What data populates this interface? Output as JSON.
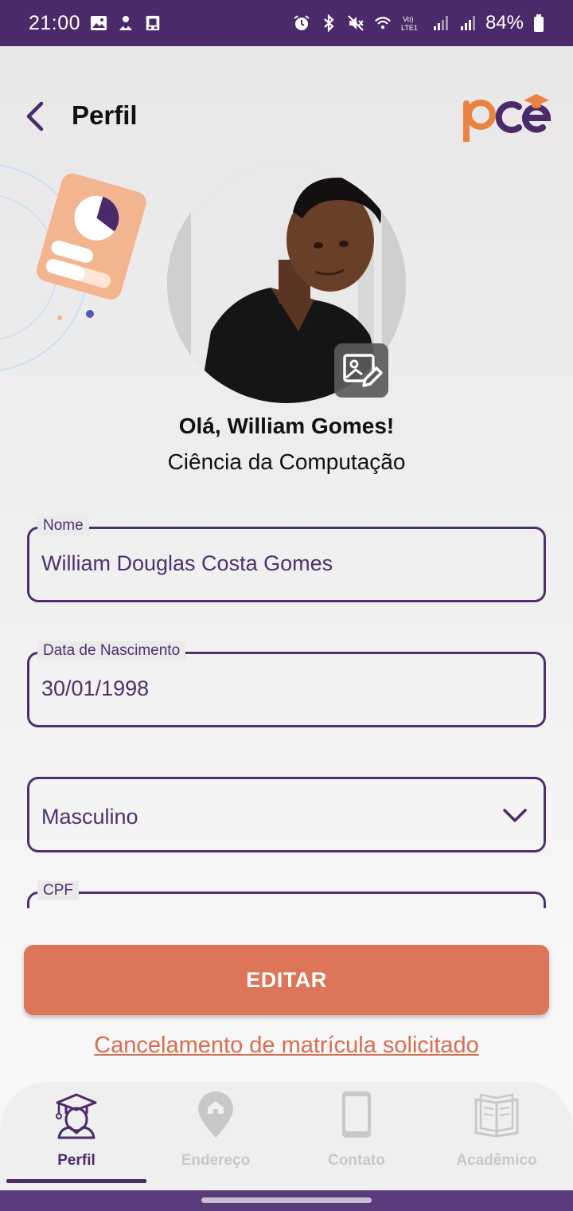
{
  "status_bar": {
    "time": "21:00",
    "battery": "84%",
    "network": "LTE1"
  },
  "header": {
    "title": "Perfil",
    "back_icon": "chevron-left-icon",
    "logo_text": "pce"
  },
  "profile": {
    "greeting": "Olá, William Gomes!",
    "course": "Ciência da Computação"
  },
  "form": {
    "name_label": "Nome",
    "name_value": "William Douglas Costa Gomes",
    "birth_label": "Data de Nascimento",
    "birth_value": "30/01/1998",
    "gender_value": "Masculino",
    "cpf_label": "CPF"
  },
  "actions": {
    "edit_label": "EDITAR",
    "cancel_link": "Cancelamento de matrícula solicitado"
  },
  "bottom_nav": {
    "items": [
      {
        "label": "Perfil",
        "icon": "graduate-icon",
        "active": true
      },
      {
        "label": "Endereço",
        "icon": "location-pin-icon",
        "active": false
      },
      {
        "label": "Contato",
        "icon": "phone-icon",
        "active": false
      },
      {
        "label": "Acadêmico",
        "icon": "book-icon",
        "active": false
      }
    ]
  },
  "colors": {
    "primary": "#4a2a68",
    "accent": "#dd7558",
    "inactive": "#c8c8c8"
  }
}
